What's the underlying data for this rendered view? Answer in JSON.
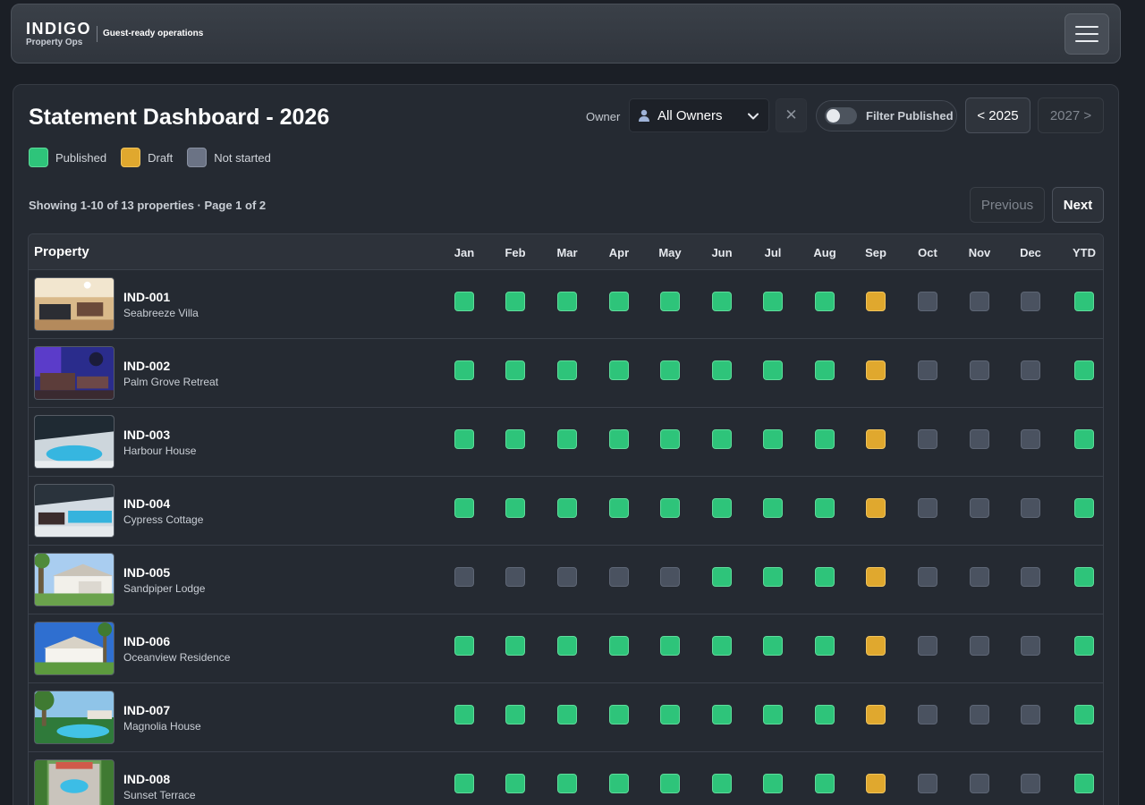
{
  "nav": {
    "brand": "INDIGO",
    "brand_sub": "Property Ops",
    "tagline": "Guest-ready operations",
    "menu_icon": "hamburger-icon"
  },
  "dashboard": {
    "title": "Statement Dashboard - 2026",
    "owner_label": "Owner",
    "owner_value": "All Owners",
    "clear_label": "✕",
    "filter_published_label": "Filter Published",
    "filter_published_on": false,
    "prev_year_label": "< 2025",
    "next_year_label": "2027 >",
    "showing": "Showing 1-10 of 13 properties · Page 1 of 2",
    "previous_label": "Previous",
    "next_label": "Next"
  },
  "colors": {
    "published": "#2ec47a",
    "draft": "#e0a82e",
    "not_started": "#4a5260"
  },
  "legend": [
    {
      "status": "published",
      "label": "Published"
    },
    {
      "status": "draft",
      "label": "Draft"
    },
    {
      "status": "not_started",
      "label": "Not started"
    }
  ],
  "table": {
    "property_header": "Property",
    "columns": [
      "Jan",
      "Feb",
      "Mar",
      "Apr",
      "May",
      "Jun",
      "Jul",
      "Aug",
      "Sep",
      "Oct",
      "Nov",
      "Dec",
      "YTD"
    ],
    "rows": [
      {
        "code": "IND-001",
        "name": "Seabreeze Villa",
        "statuses": [
          "published",
          "published",
          "published",
          "published",
          "published",
          "published",
          "published",
          "published",
          "draft",
          "not_started",
          "not_started",
          "not_started",
          "published"
        ]
      },
      {
        "code": "IND-002",
        "name": "Palm Grove Retreat",
        "statuses": [
          "published",
          "published",
          "published",
          "published",
          "published",
          "published",
          "published",
          "published",
          "draft",
          "not_started",
          "not_started",
          "not_started",
          "published"
        ]
      },
      {
        "code": "IND-003",
        "name": "Harbour House",
        "statuses": [
          "published",
          "published",
          "published",
          "published",
          "published",
          "published",
          "published",
          "published",
          "draft",
          "not_started",
          "not_started",
          "not_started",
          "published"
        ]
      },
      {
        "code": "IND-004",
        "name": "Cypress Cottage",
        "statuses": [
          "published",
          "published",
          "published",
          "published",
          "published",
          "published",
          "published",
          "published",
          "draft",
          "not_started",
          "not_started",
          "not_started",
          "published"
        ]
      },
      {
        "code": "IND-005",
        "name": "Sandpiper Lodge",
        "statuses": [
          "not_started",
          "not_started",
          "not_started",
          "not_started",
          "not_started",
          "published",
          "published",
          "published",
          "draft",
          "not_started",
          "not_started",
          "not_started",
          "published"
        ]
      },
      {
        "code": "IND-006",
        "name": "Oceanview Residence",
        "statuses": [
          "published",
          "published",
          "published",
          "published",
          "published",
          "published",
          "published",
          "published",
          "draft",
          "not_started",
          "not_started",
          "not_started",
          "published"
        ]
      },
      {
        "code": "IND-007",
        "name": "Magnolia House",
        "statuses": [
          "published",
          "published",
          "published",
          "published",
          "published",
          "published",
          "published",
          "published",
          "draft",
          "not_started",
          "not_started",
          "not_started",
          "published"
        ]
      },
      {
        "code": "IND-008",
        "name": "Sunset Terrace",
        "statuses": [
          "published",
          "published",
          "published",
          "published",
          "published",
          "published",
          "published",
          "published",
          "draft",
          "not_started",
          "not_started",
          "not_started",
          "published"
        ]
      }
    ]
  }
}
